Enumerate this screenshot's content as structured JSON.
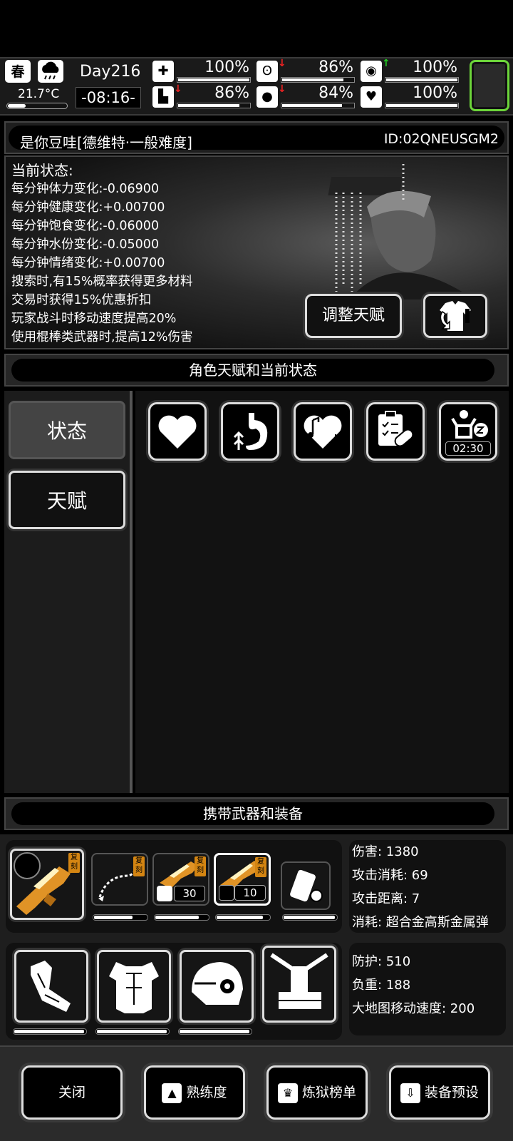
{
  "weather": {
    "season": "春",
    "temperature": "21.7°C",
    "temperature_level": 0.3
  },
  "clock": {
    "day": "Day216",
    "time": "-08:16-"
  },
  "vitals": [
    {
      "icon": "medkit-icon",
      "value": "100%",
      "level": 1.0,
      "trend": ""
    },
    {
      "icon": "stomach-icon",
      "value": "86%",
      "level": 0.86,
      "trend": "down"
    },
    {
      "icon": "bladder-icon",
      "value": "100%",
      "level": 1.0,
      "trend": "up"
    },
    {
      "icon": "boot-icon",
      "value": "86%",
      "level": 0.86,
      "trend": "down"
    },
    {
      "icon": "water-drop-icon",
      "value": "84%",
      "level": 0.84,
      "trend": "down"
    },
    {
      "icon": "heart-icon",
      "value": "100%",
      "level": 1.0,
      "trend": ""
    }
  ],
  "character": {
    "name": "是你豆哇[德维特·一般难度]",
    "id": "ID:02QNEUSGM2"
  },
  "status": {
    "heading": "当前状态:",
    "lines": [
      "每分钟体力变化:-0.06900",
      "每分钟健康变化:+0.00700",
      "每分钟饱食变化:-0.06000",
      "每分钟水份变化:-0.05000",
      "每分钟情绪变化:+0.00700",
      "搜索时,有15%概率获得更多材料",
      "交易时获得15%优惠折扣",
      "玩家战斗时移动速度提高20%",
      "使用棍棒类武器时,提高12%伤害"
    ],
    "adjust_talent_label": "调整天赋"
  },
  "talent_section": {
    "title": "角色天赋和当前状态",
    "tabs": [
      "状态",
      "天赋"
    ],
    "effects": [
      {
        "icon": "heart-icon",
        "timer": ""
      },
      {
        "icon": "stomach-up-icon",
        "timer": ""
      },
      {
        "icon": "music-heart-icon",
        "timer": ""
      },
      {
        "icon": "medical-report-icon",
        "timer": ""
      },
      {
        "icon": "tired-sleep-icon",
        "timer": "02:30"
      }
    ]
  },
  "equipment_section": {
    "title": "携带武器和装备",
    "copy_tag": "复刻",
    "weapon_counts": [
      "30",
      "10"
    ],
    "weapon_durability": [
      1.0,
      0.75,
      0.85,
      0.9,
      1.0
    ],
    "armor_durability": [
      1.0,
      1.0,
      1.0
    ],
    "weapon_stats": [
      "伤害: 1380",
      "攻击消耗: 69",
      "攻击距离: 7",
      "消耗: 超合金高斯金属弹"
    ],
    "armor_stats": [
      "防护: 510",
      "负重: 188",
      "大地图移动速度: 200"
    ]
  },
  "bottom_buttons": {
    "close": "关闭",
    "proficiency": "熟练度",
    "ranking": "炼狱榜单",
    "preset": "装备预设"
  },
  "colors": {
    "accent_green": "#6cd43a",
    "copy_tag": "#d48512",
    "warn_red": "#e22222",
    "up_green": "#22cc22"
  }
}
